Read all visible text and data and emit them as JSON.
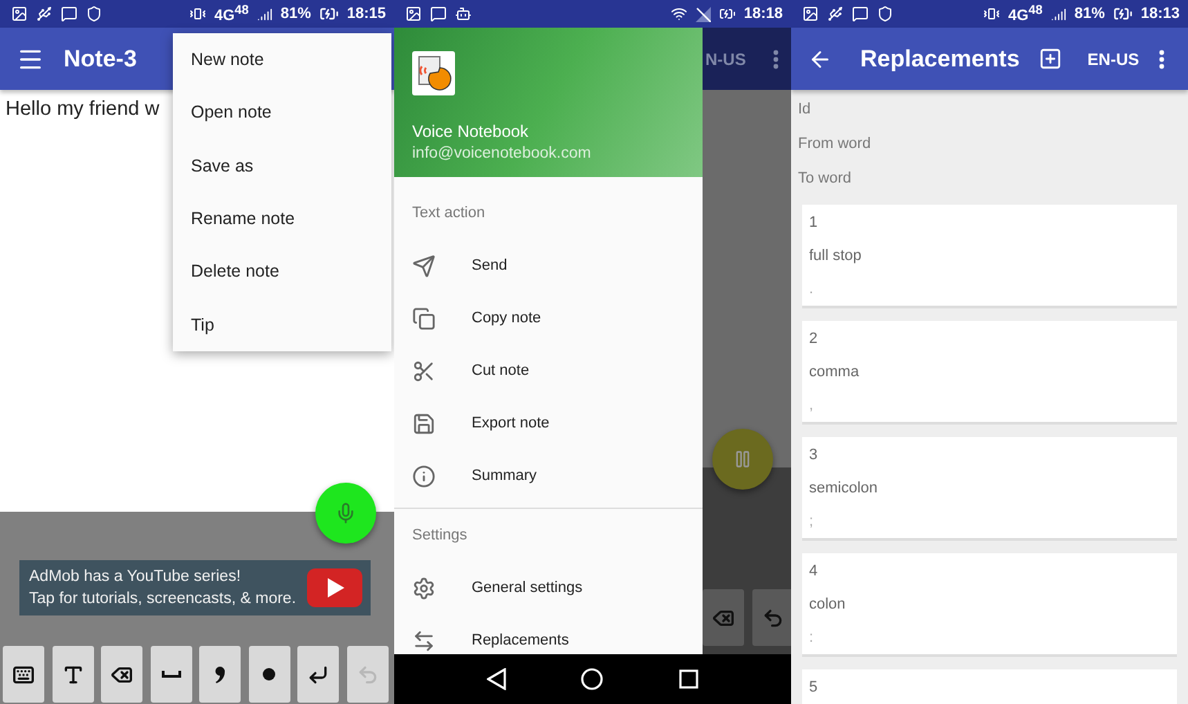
{
  "note_screen": {
    "status_bar": {
      "network": "4G$^{48}$",
      "battery": "81%",
      "time": "18:15"
    },
    "app_bar": {
      "title": "Note-3"
    },
    "note_text": "Hello my friend w",
    "menu": [
      "New note",
      "Open note",
      "Save as",
      "Rename note",
      "Delete note",
      "Tip"
    ],
    "ad": {
      "lines": [
        "AdMob has a YouTube series!",
        "Tap for tutorials, screencasts, & more."
      ]
    },
    "keys": [
      {
        "kind": "keyboard",
        "disabled": false
      },
      {
        "kind": "text-size",
        "disabled": false
      },
      {
        "kind": "backspace",
        "disabled": false
      },
      {
        "kind": "space",
        "disabled": false
      },
      {
        "kind": "comma",
        "disabled": false
      },
      {
        "kind": "dot",
        "disabled": false
      },
      {
        "kind": "enter",
        "disabled": false
      },
      {
        "kind": "undo",
        "disabled": true
      }
    ]
  },
  "drawer_screen": {
    "status_bar": {
      "time": "18:18"
    },
    "header": {
      "name": "Voice Notebook",
      "email": "info@voicenotebook.com"
    },
    "sections": [
      {
        "title": "Text action",
        "items": [
          {
            "kind": "send",
            "label": "Send"
          },
          {
            "kind": "copy",
            "label": "Copy note"
          },
          {
            "kind": "cut",
            "label": "Cut note"
          },
          {
            "kind": "export",
            "label": "Export note"
          },
          {
            "kind": "summary",
            "label": "Summary"
          }
        ]
      },
      {
        "title": "Settings",
        "items": [
          {
            "kind": "settings",
            "label": "General settings"
          },
          {
            "kind": "replacements",
            "label": "Replacements"
          }
        ]
      }
    ],
    "background_app": {
      "language": "N-US",
      "keys": [
        {
          "kind": "backspace",
          "disabled": false
        },
        {
          "kind": "undo",
          "disabled": false
        }
      ]
    }
  },
  "replacements_screen": {
    "status_bar": {
      "network": "4G$^{48}$",
      "battery": "81%",
      "time": "18:13"
    },
    "app_bar": {
      "title": "Replacements",
      "language": "EN-US"
    },
    "field_labels": [
      "Id",
      "From word",
      "To word"
    ],
    "entries": [
      {
        "id": "1",
        "from": "full stop",
        "to": "."
      },
      {
        "id": "2",
        "from": "comma",
        "to": ","
      },
      {
        "id": "3",
        "from": "semicolon",
        "to": ";"
      },
      {
        "id": "4",
        "from": "colon",
        "to": ":"
      },
      {
        "id": "5"
      }
    ]
  }
}
